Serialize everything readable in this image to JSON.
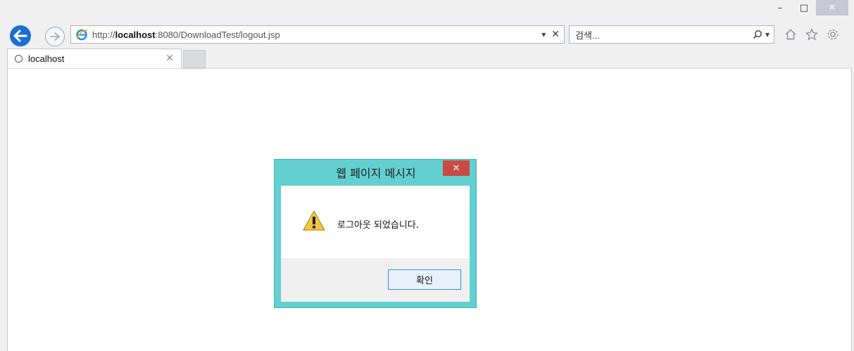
{
  "window": {
    "controls": {
      "minimize": "–",
      "maximize": "□",
      "close": "✕"
    }
  },
  "navigation": {
    "back_icon": "back-arrow-icon",
    "forward_icon": "forward-arrow-icon",
    "address": {
      "protocol": "http://",
      "host": "localhost",
      "path": ":8080/DownloadTest/logout.jsp",
      "dropdown": "▾",
      "stop": "✕"
    },
    "search": {
      "placeholder": "검색...",
      "search_icon": "⌕",
      "dropdown": "▾"
    },
    "toolbar_icons": [
      "home-icon",
      "favorites-star-icon",
      "settings-gear-icon"
    ]
  },
  "tabs": [
    {
      "label": "localhost",
      "close": "✕",
      "loading": true
    }
  ],
  "dialog": {
    "title": "웹 페이지 메시지",
    "close": "✕",
    "icon": "warning-icon",
    "message": "로그아웃 되었습니다.",
    "ok_label": "확인"
  },
  "colors": {
    "dialog_frame": "#64cfd0",
    "dialog_close": "#c94a45",
    "back_button": "#1c6fd1",
    "ok_border": "#3c8ddc"
  }
}
